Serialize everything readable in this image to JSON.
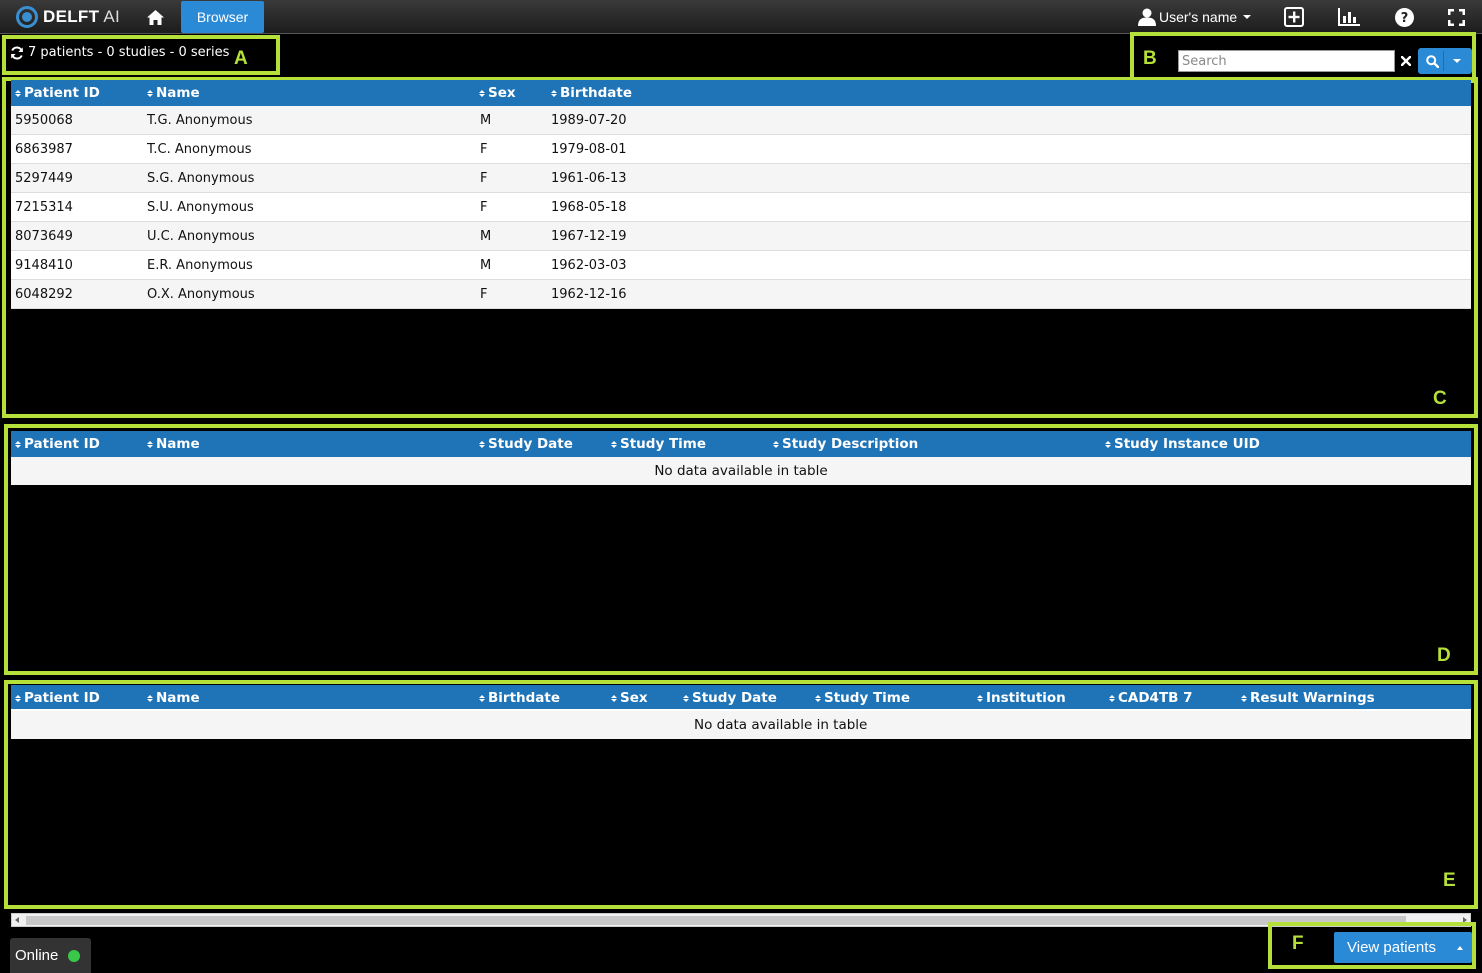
{
  "app": {
    "logo_bold": "DELFT",
    "logo_light": " AI",
    "browser_tab": "Browser",
    "user_name": "User's name"
  },
  "icons": {
    "home": "home-icon",
    "add": "plus-square-icon",
    "chart": "bar-chart-icon",
    "help": "question-circle-icon",
    "fullscreen": "fullscreen-icon",
    "refresh": "refresh-icon",
    "search": "search-icon",
    "clear": "close-icon"
  },
  "colors": {
    "accent": "#2b8ad6",
    "table_header": "#1f73b7",
    "highlight": "#b5e03a",
    "online": "#3ac84a"
  },
  "status": {
    "summary": "7 patients - 0 studies - 0 series"
  },
  "search": {
    "placeholder": "Search",
    "value": ""
  },
  "frames": {
    "a": "A",
    "b": "B",
    "c": "C",
    "d": "D",
    "e": "E",
    "f": "F"
  },
  "patients_table": {
    "columns": [
      "Patient ID",
      "Name",
      "Sex",
      "Birthdate"
    ],
    "rows": [
      [
        "5950068",
        "T.G. Anonymous",
        "M",
        "1989-07-20"
      ],
      [
        "6863987",
        "T.C. Anonymous",
        "F",
        "1979-08-01"
      ],
      [
        "5297449",
        "S.G. Anonymous",
        "F",
        "1961-06-13"
      ],
      [
        "7215314",
        "S.U. Anonymous",
        "F",
        "1968-05-18"
      ],
      [
        "8073649",
        "U.C. Anonymous",
        "M",
        "1967-12-19"
      ],
      [
        "9148410",
        "E.R. Anonymous",
        "M",
        "1962-03-03"
      ],
      [
        "6048292",
        "O.X. Anonymous",
        "F",
        "1962-12-16"
      ]
    ]
  },
  "studies_table": {
    "columns": [
      "Patient ID",
      "Name",
      "Study Date",
      "Study Time",
      "Study Description",
      "Study Instance UID"
    ],
    "empty_text": "No data available in table"
  },
  "series_table": {
    "columns": [
      "Patient ID",
      "Name",
      "Birthdate",
      "Sex",
      "Study Date",
      "Study Time",
      "Institution",
      "CAD4TB 7",
      "Result Warnings"
    ],
    "empty_text": "No data available in table"
  },
  "footer": {
    "online_label": "Online",
    "view_button": "View patients"
  }
}
